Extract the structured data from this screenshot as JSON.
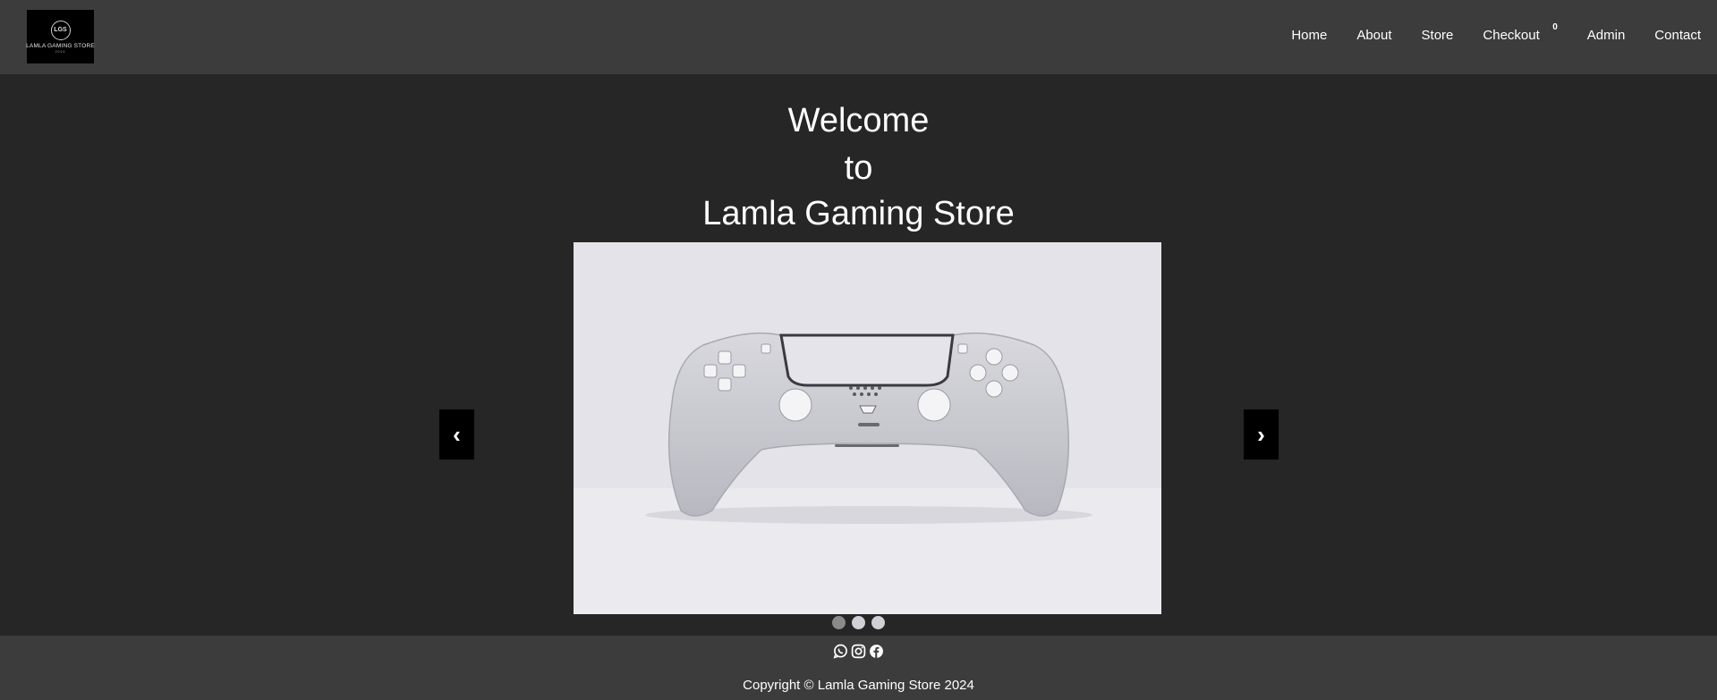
{
  "header": {
    "logo": {
      "mark": "LGS",
      "text": "LAMLA GAMING STORE",
      "sub": "2024"
    },
    "nav": [
      {
        "label": "Home"
      },
      {
        "label": "About"
      },
      {
        "label": "Store"
      },
      {
        "label": "Checkout",
        "badge": "0"
      },
      {
        "label": "Admin"
      },
      {
        "label": "Contact"
      }
    ]
  },
  "hero": {
    "title_lines": [
      "Welcome",
      "to",
      "Lamla Gaming Store"
    ],
    "image_subject": "white-game-controller",
    "prev": "‹",
    "next": "›",
    "slide_count": 3,
    "active_slide": 1
  },
  "footer": {
    "social": [
      "whatsapp-icon",
      "instagram-icon",
      "facebook-icon"
    ],
    "copyright": "Copyright © Lamla Gaming Store 2024"
  },
  "colors": {
    "header_bg": "#3c3c3c",
    "page_bg": "#262626",
    "arrow_bg": "#000000"
  }
}
